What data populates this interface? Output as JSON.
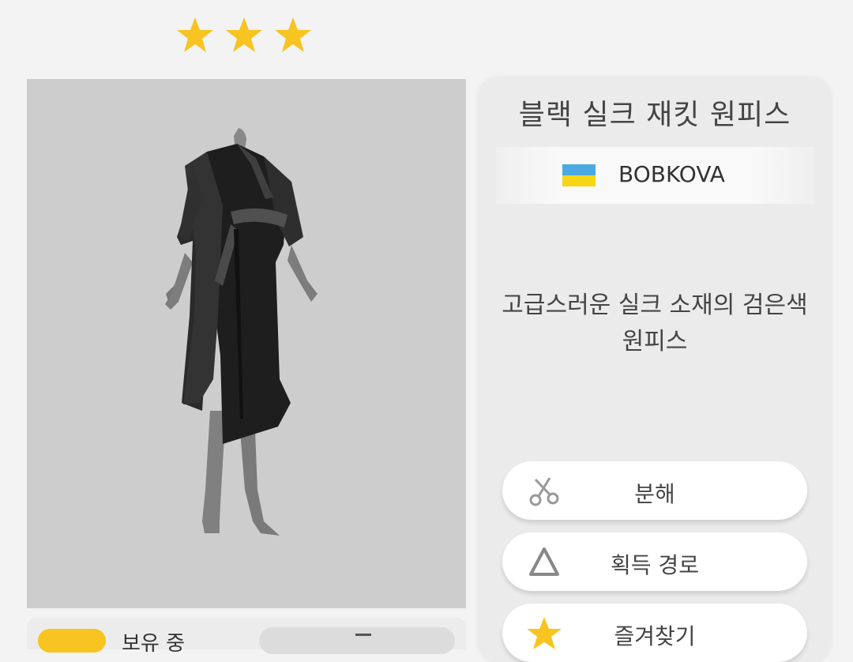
{
  "rating": {
    "stars": 3,
    "star_color": "#f7c421"
  },
  "item": {
    "title": "블랙 실크 재킷 원피스",
    "designer": "BOBKOVA",
    "designer_flag": "ukraine-flag",
    "description": "고급스러운 실크 소재의 검은색 원피스"
  },
  "actions": [
    {
      "label": "분해",
      "icon": "scissors-icon"
    },
    {
      "label": "획득 경로",
      "icon": "triangle-icon"
    },
    {
      "label": "즐겨찾기",
      "icon": "star-icon"
    }
  ],
  "inventory": {
    "owned_label": "보유 중"
  },
  "colors": {
    "accent": "#f7c421",
    "preview_bg": "#cdcdcd",
    "panel_bg": "#ebebeb"
  }
}
